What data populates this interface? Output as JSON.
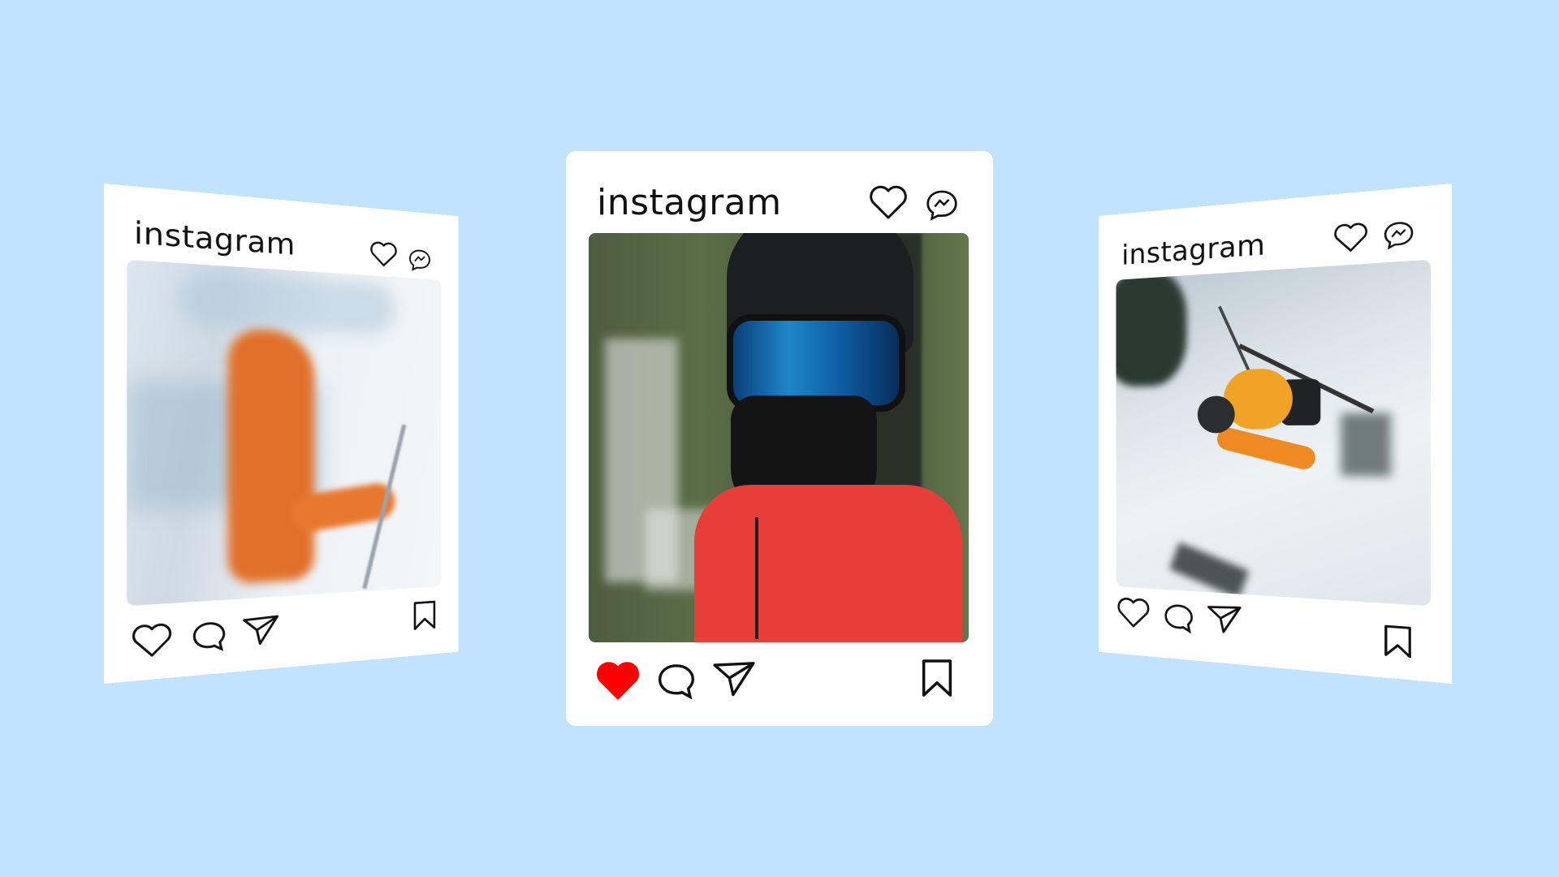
{
  "background_color": "#c2e3fd",
  "accent_like_color": "#ff0000",
  "posts": [
    {
      "brand": "instagram",
      "liked": false,
      "photo_alt_subject": "orange-jacket skier photo"
    },
    {
      "brand": "instagram",
      "liked": true,
      "photo_alt_subject": "helmet and goggles photo"
    },
    {
      "brand": "instagram",
      "liked": false,
      "photo_alt_subject": "airborne skier photo"
    }
  ],
  "icons": {
    "header_like": "heart-outline-icon",
    "header_messages": "messenger-icon",
    "like": "heart-icon",
    "comment": "comment-bubble-icon",
    "share": "paper-plane-icon",
    "save": "bookmark-icon"
  }
}
